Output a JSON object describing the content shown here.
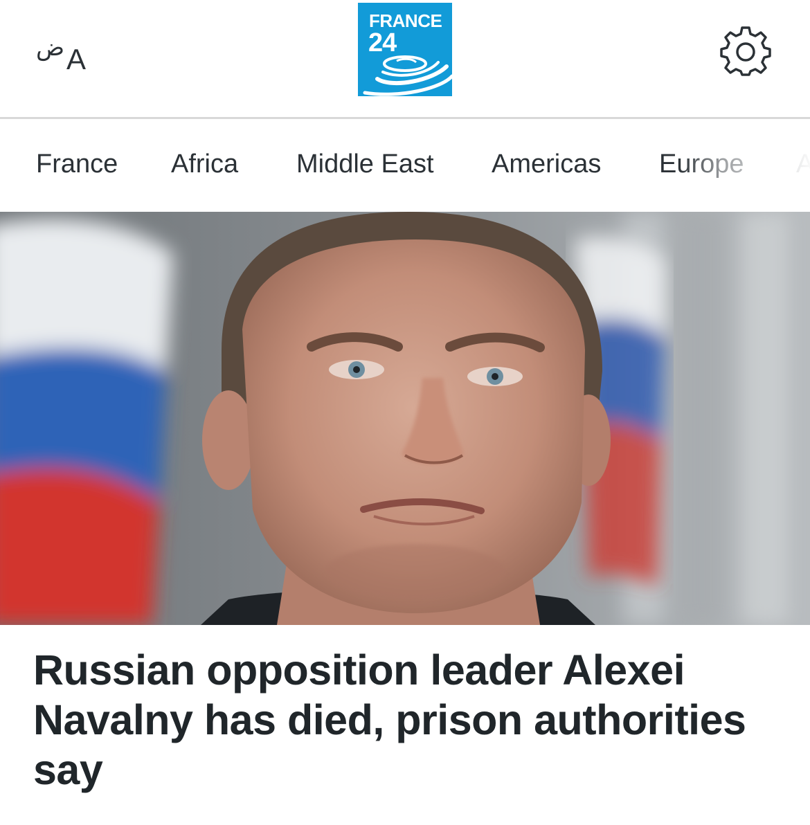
{
  "header": {
    "language_icon": "language-switch-icon",
    "language_glyph_arabic": "ض",
    "language_glyph_latin": "A",
    "logo": {
      "line1": "FRANCE",
      "line2": "24",
      "background_color": "#129bd8"
    },
    "settings_icon": "gear-icon"
  },
  "nav": {
    "items": [
      {
        "label": "France"
      },
      {
        "label": "Africa"
      },
      {
        "label": "Middle East"
      },
      {
        "label": "Americas"
      },
      {
        "label": "Europe"
      },
      {
        "label": "A"
      }
    ]
  },
  "article": {
    "image_icon": "news-photo",
    "headline": "Russian opposition leader Alexei Navalny has died, prison authorities say"
  },
  "colors": {
    "text": "#20262a",
    "divider": "#d8d8d8",
    "brand": "#129bd8"
  }
}
